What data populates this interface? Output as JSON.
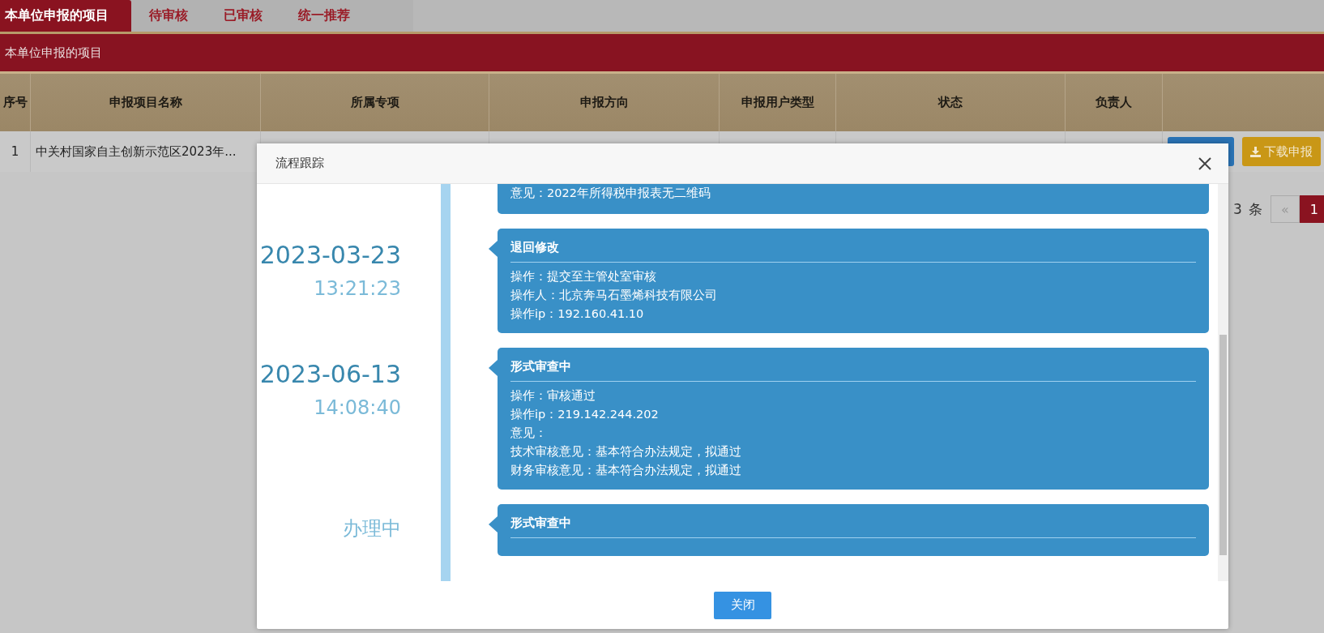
{
  "tabs": [
    {
      "label": "本单位申报的项目",
      "selected": true
    },
    {
      "label": "待审核",
      "selected": false
    },
    {
      "label": "已审核",
      "selected": false
    },
    {
      "label": "统一推荐",
      "selected": false
    }
  ],
  "section_title": "本单位申报的项目",
  "table": {
    "columns": [
      "序号",
      "申报项目名称",
      "所属专项",
      "申报方向",
      "申报用户类型",
      "状态",
      "负责人",
      ""
    ],
    "rows": [
      {
        "cells": [
          "1",
          "中关村国家自主创新示范区2023年..."
        ],
        "actions": [
          {
            "kind": "primary"
          },
          {
            "kind": "download",
            "label": "下载申报"
          }
        ]
      }
    ]
  },
  "pagination": {
    "total": "3",
    "unit": "条",
    "prev": "«",
    "pages": [
      {
        "label": "1",
        "selected": true
      }
    ]
  },
  "dialog": {
    "title": "流程跟踪",
    "entries": [
      {
        "lines": [
          "意见：2022年所得税申报表无二维码"
        ]
      },
      {
        "date": "2023-03-23",
        "time": "13:21:23",
        "title": "退回修改",
        "lines": [
          "操作：提交至主管处室审核",
          "操作人：北京奔马石墨烯科技有限公司",
          "操作ip：192.160.41.10"
        ]
      },
      {
        "date": "2023-06-13",
        "time": "14:08:40",
        "title": "形式审查中",
        "lines": [
          "操作：审核通过",
          "操作ip：219.142.244.202",
          "意见：",
          "技术审核意见：基本符合办法规定，拟通过",
          "财务审核意见：基本符合办法规定，拟通过"
        ]
      },
      {
        "status": "办理中",
        "title": "形式审查中"
      }
    ],
    "close_button": "关闭"
  }
}
